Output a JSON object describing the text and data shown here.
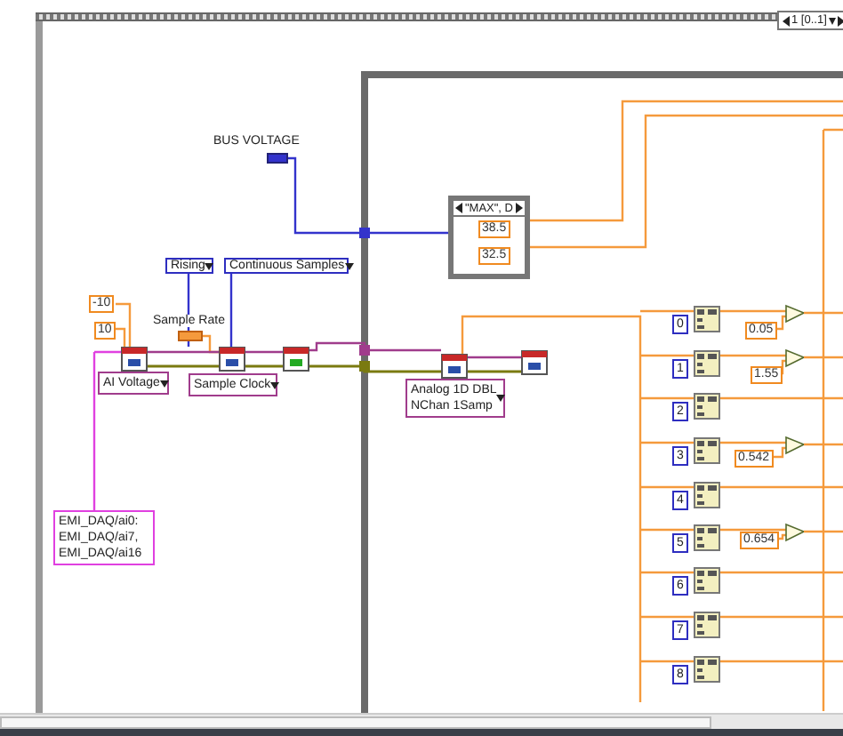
{
  "sequence_frame": {
    "selector": "1 [0..1]"
  },
  "bus_voltage": {
    "label": "BUS VOLTAGE"
  },
  "case_structure": {
    "selector": "\"MAX\", D",
    "constants": [
      "38.5",
      "32.5"
    ]
  },
  "enums": [
    {
      "text": "Rising"
    },
    {
      "text": "Continuous Samples"
    }
  ],
  "range_constants": [
    "-10",
    "10"
  ],
  "sample_rate": {
    "label": "Sample Rate"
  },
  "selectors": [
    {
      "lines": [
        "AI Voltage"
      ]
    },
    {
      "lines": [
        "Sample Clock"
      ]
    },
    {
      "lines": [
        "Analog 1D DBL",
        "NChan 1Samp"
      ]
    }
  ],
  "channels": {
    "lines": [
      "EMI_DAQ/ai0:",
      "EMI_DAQ/ai7,",
      "EMI_DAQ/ai16"
    ]
  },
  "indices": [
    "0",
    "1",
    "2",
    "3",
    "4",
    "5",
    "6",
    "7",
    "8"
  ],
  "thresholds": [
    "0.05",
    "1.55",
    "0.542",
    "0.654"
  ]
}
